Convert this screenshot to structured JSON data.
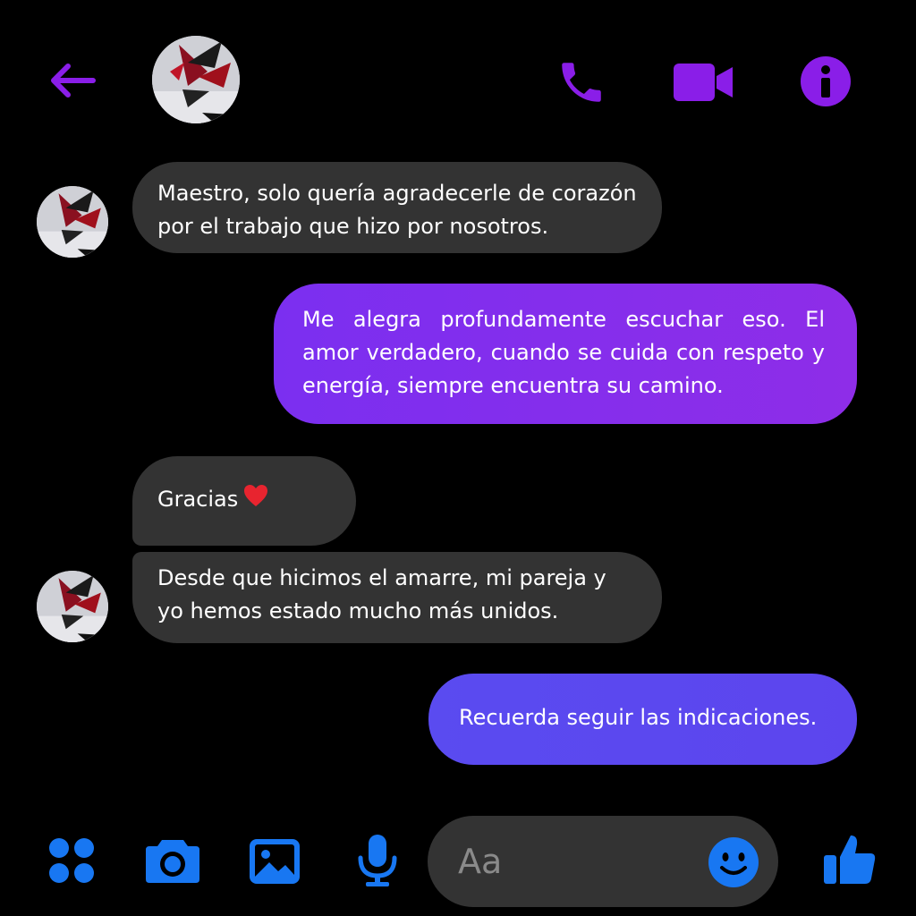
{
  "header": {
    "back_icon": "arrow-left-icon",
    "call_icon": "phone-icon",
    "video_icon": "video-camera-icon",
    "info_icon": "info-icon",
    "accent_color": "#8a1ee8"
  },
  "messages": [
    {
      "direction": "incoming",
      "text": "Maestro, solo quería agradecerle de corazón por el trabajo que hizo por nosotros."
    },
    {
      "direction": "outgoing",
      "text": "Me alegra profundamente escuchar eso. El amor verdadero, cuando se cuida con respeto y energía, siempre encuentra su camino."
    },
    {
      "direction": "incoming",
      "text": "Gracias",
      "emoji": "red-heart"
    },
    {
      "direction": "incoming",
      "text": "Desde que hicimos el amarre, mi pareja y yo hemos estado mucho más unidos."
    },
    {
      "direction": "outgoing",
      "text": "Recuerda seguir las indicaciones."
    }
  ],
  "composer": {
    "placeholder": "Aa",
    "icons": [
      "apps-grid-icon",
      "camera-icon",
      "gallery-icon",
      "microphone-icon",
      "emoji-icon",
      "thumbs-up-icon"
    ],
    "accent_color": "#1877f2"
  }
}
